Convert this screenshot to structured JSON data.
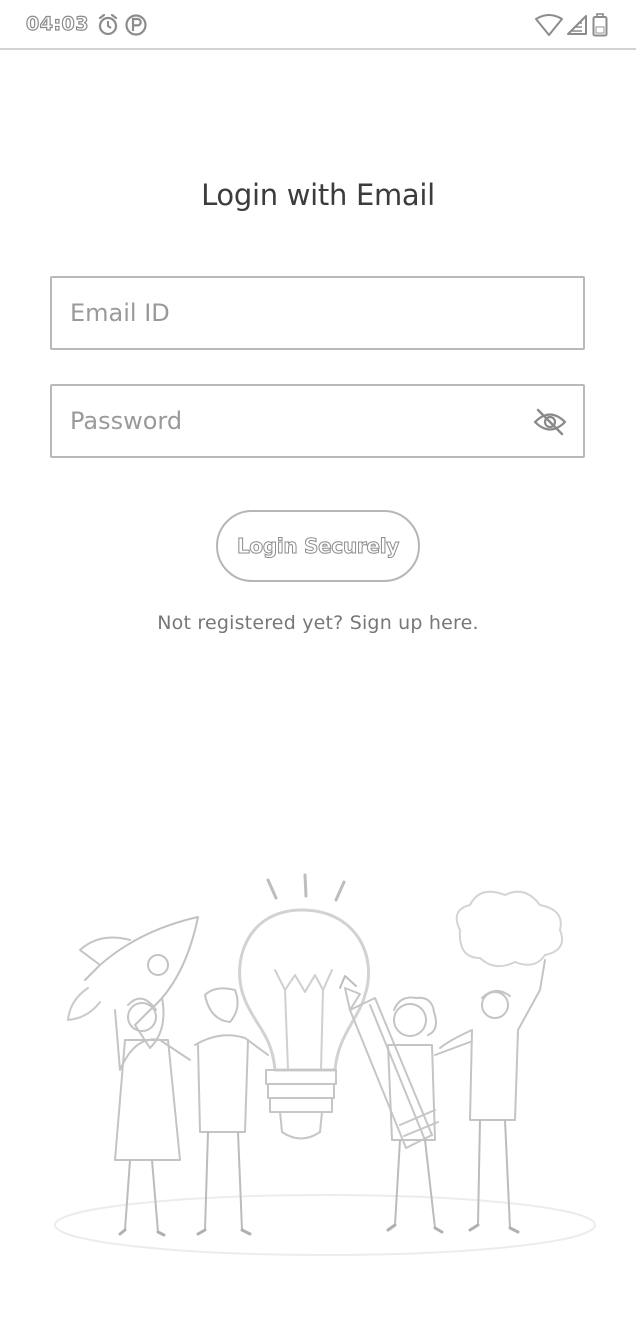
{
  "status_bar": {
    "time": "04:03",
    "icons": [
      "alarm-icon",
      "parking-icon",
      "wifi-icon",
      "signal-icon",
      "battery-icon"
    ]
  },
  "login": {
    "title": "Login with Email",
    "email_placeholder": "Email ID",
    "password_placeholder": "Password",
    "submit_label": "Login Securely",
    "signup_text": "Not registered yet? Sign up here."
  },
  "illustration": {
    "name": "team-ideas-illustration"
  },
  "colors": {
    "border": "#b9b9b9",
    "title": "#3c3c3c",
    "placeholder": "#9a9a9a",
    "link": "#777777"
  }
}
